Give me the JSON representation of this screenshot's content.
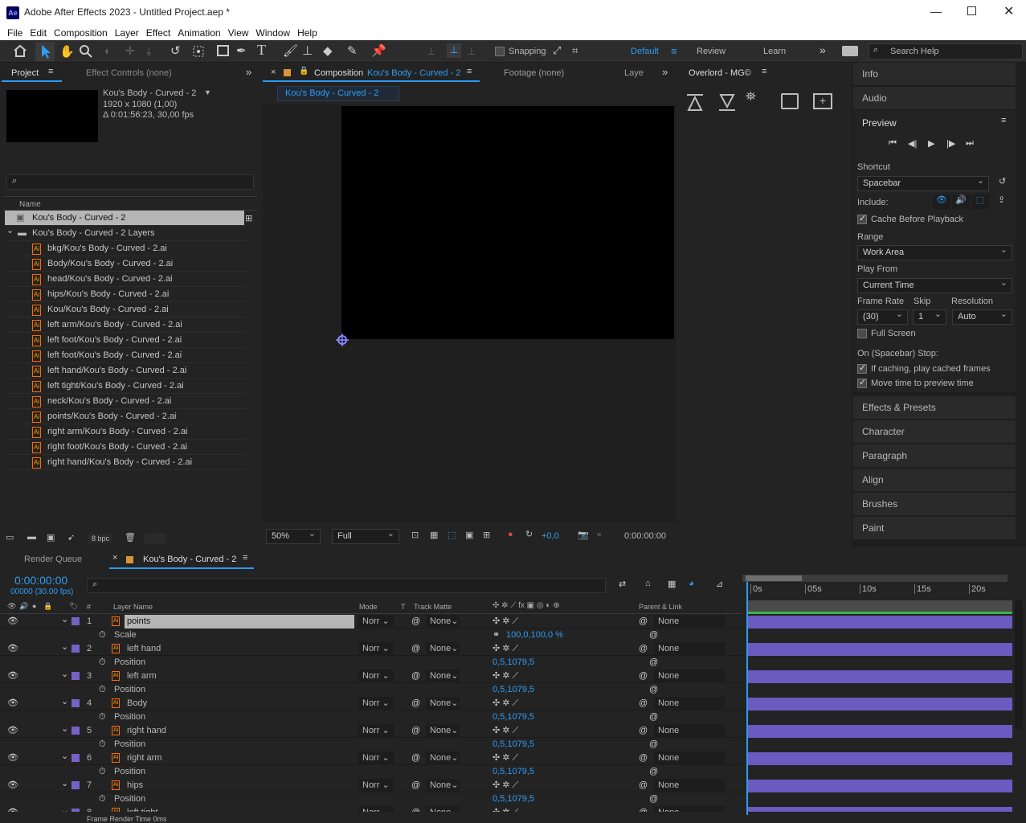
{
  "window": {
    "app_icon": "Ae",
    "title": "Adobe After Effects 2023 - Untitled Project.aep *"
  },
  "menu": [
    "File",
    "Edit",
    "Composition",
    "Layer",
    "Effect",
    "Animation",
    "View",
    "Window",
    "Help"
  ],
  "toolbar": {
    "snapping": "Snapping",
    "workspaces": [
      "Default",
      "Review",
      "Learn"
    ],
    "search_placeholder": "Search Help"
  },
  "project_panel": {
    "tab": "Project",
    "tab2": "Effect Controls (none)",
    "item_name": "Kou's Body - Curved - 2",
    "item_dims": "1920 x 1080 (1,00)",
    "item_duration": "Δ 0:01:56:23, 30,00 fps",
    "col_name": "Name",
    "bpc": "8 bpc",
    "items": [
      {
        "name": "Kou's Body - Curved - 2",
        "kind": "comp",
        "selected": true
      },
      {
        "name": "Kou's Body - Curved - 2 Layers",
        "kind": "folder"
      },
      {
        "name": "bkg/Kou's Body - Curved - 2.ai",
        "kind": "ai"
      },
      {
        "name": "Body/Kou's Body - Curved - 2.ai",
        "kind": "ai"
      },
      {
        "name": "head/Kou's Body - Curved - 2.ai",
        "kind": "ai"
      },
      {
        "name": "hips/Kou's Body - Curved - 2.ai",
        "kind": "ai"
      },
      {
        "name": "Kou/Kou's Body - Curved - 2.ai",
        "kind": "ai"
      },
      {
        "name": "left arm/Kou's Body - Curved - 2.ai",
        "kind": "ai"
      },
      {
        "name": "left foot/Kou's Body - Curved - 2.ai",
        "kind": "ai"
      },
      {
        "name": "left foot/Kou's Body - Curved - 2.ai",
        "kind": "ai"
      },
      {
        "name": "left hand/Kou's Body - Curved - 2.ai",
        "kind": "ai"
      },
      {
        "name": "left tight/Kou's Body - Curved - 2.ai",
        "kind": "ai"
      },
      {
        "name": "neck/Kou's Body - Curved - 2.ai",
        "kind": "ai"
      },
      {
        "name": "points/Kou's Body - Curved - 2.ai",
        "kind": "ai"
      },
      {
        "name": "right arm/Kou's Body - Curved - 2.ai",
        "kind": "ai"
      },
      {
        "name": "right foot/Kou's Body - Curved - 2.ai",
        "kind": "ai"
      },
      {
        "name": "right hand/Kou's Body - Curved - 2.ai",
        "kind": "ai"
      }
    ]
  },
  "comp_panel": {
    "tab_prefix": "Composition",
    "tab_name": "Kou's Body - Curved - 2",
    "footage_tab": "Footage (none)",
    "layer_tab": "Laye",
    "breadcrumb": "Kou's Body - Curved - 2",
    "zoom": "50%",
    "resolution": "Full",
    "exposure": "+0,0",
    "timecode": "0:00:00:00"
  },
  "overlord": {
    "title": "Overlord - MG©"
  },
  "right_panel": {
    "info": "Info",
    "audio": "Audio",
    "preview": "Preview",
    "shortcut_label": "Shortcut",
    "shortcut_value": "Spacebar",
    "include_label": "Include:",
    "cache_before": "Cache Before Playback",
    "range_label": "Range",
    "range_value": "Work Area",
    "play_from_label": "Play From",
    "play_from_value": "Current Time",
    "frame_rate_label": "Frame Rate",
    "skip_label": "Skip",
    "resolution_label": "Resolution",
    "frame_rate_value": "(30)",
    "skip_value": "1",
    "resolution_value": "Auto",
    "full_screen": "Full Screen",
    "on_stop": "On (Spacebar) Stop:",
    "if_caching": "If caching, play cached frames",
    "move_time": "Move time to preview time",
    "sections": [
      "Effects & Presets",
      "Character",
      "Paragraph",
      "Align",
      "Brushes",
      "Paint"
    ]
  },
  "timeline": {
    "render_queue": "Render Queue",
    "comp_tab": "Kou's Body - Curved - 2",
    "timecode": "0:00:00:00",
    "frames": "00000 (30.00 fps)",
    "headers": {
      "num": "#",
      "layer_name": "Layer Name",
      "mode": "Mode",
      "t": "T",
      "track_matte": "Track Matte",
      "parent": "Parent & Link"
    },
    "ruler": [
      "0s",
      "05s",
      "10s",
      "15s",
      "20s"
    ],
    "footer": "Frame Render Time  0ms",
    "layers": [
      {
        "num": "1",
        "name": "points",
        "prop": "Scale",
        "value": "100,0,100,0 %",
        "mode": "Norr",
        "matte": "None",
        "parent": "None"
      },
      {
        "num": "2",
        "name": "left hand",
        "prop": "Position",
        "value": "0,5,1079,5",
        "mode": "Norr",
        "matte": "None",
        "parent": "None"
      },
      {
        "num": "3",
        "name": "left arm",
        "prop": "Position",
        "value": "0,5,1079,5",
        "mode": "Norr",
        "matte": "None",
        "parent": "None"
      },
      {
        "num": "4",
        "name": "Body",
        "prop": "Position",
        "value": "0,5,1079,5",
        "mode": "Norr",
        "matte": "None",
        "parent": "None"
      },
      {
        "num": "5",
        "name": "right hand",
        "prop": "Position",
        "value": "0,5,1079,5",
        "mode": "Norr",
        "matte": "None",
        "parent": "None"
      },
      {
        "num": "6",
        "name": "right arm",
        "prop": "Position",
        "value": "0,5,1079,5",
        "mode": "Norr",
        "matte": "None",
        "parent": "None"
      },
      {
        "num": "7",
        "name": "hips",
        "prop": "Position",
        "value": "0,5,1079,5",
        "mode": "Norr",
        "matte": "None",
        "parent": "None"
      },
      {
        "num": "8",
        "name": "left tight",
        "prop": "",
        "value": "",
        "mode": "Norr",
        "matte": "None",
        "parent": "None"
      }
    ]
  },
  "colors": {
    "accent": "#2e9cf5",
    "label_purple": "#7462c5",
    "bar_purple": "#6b5bc0"
  }
}
